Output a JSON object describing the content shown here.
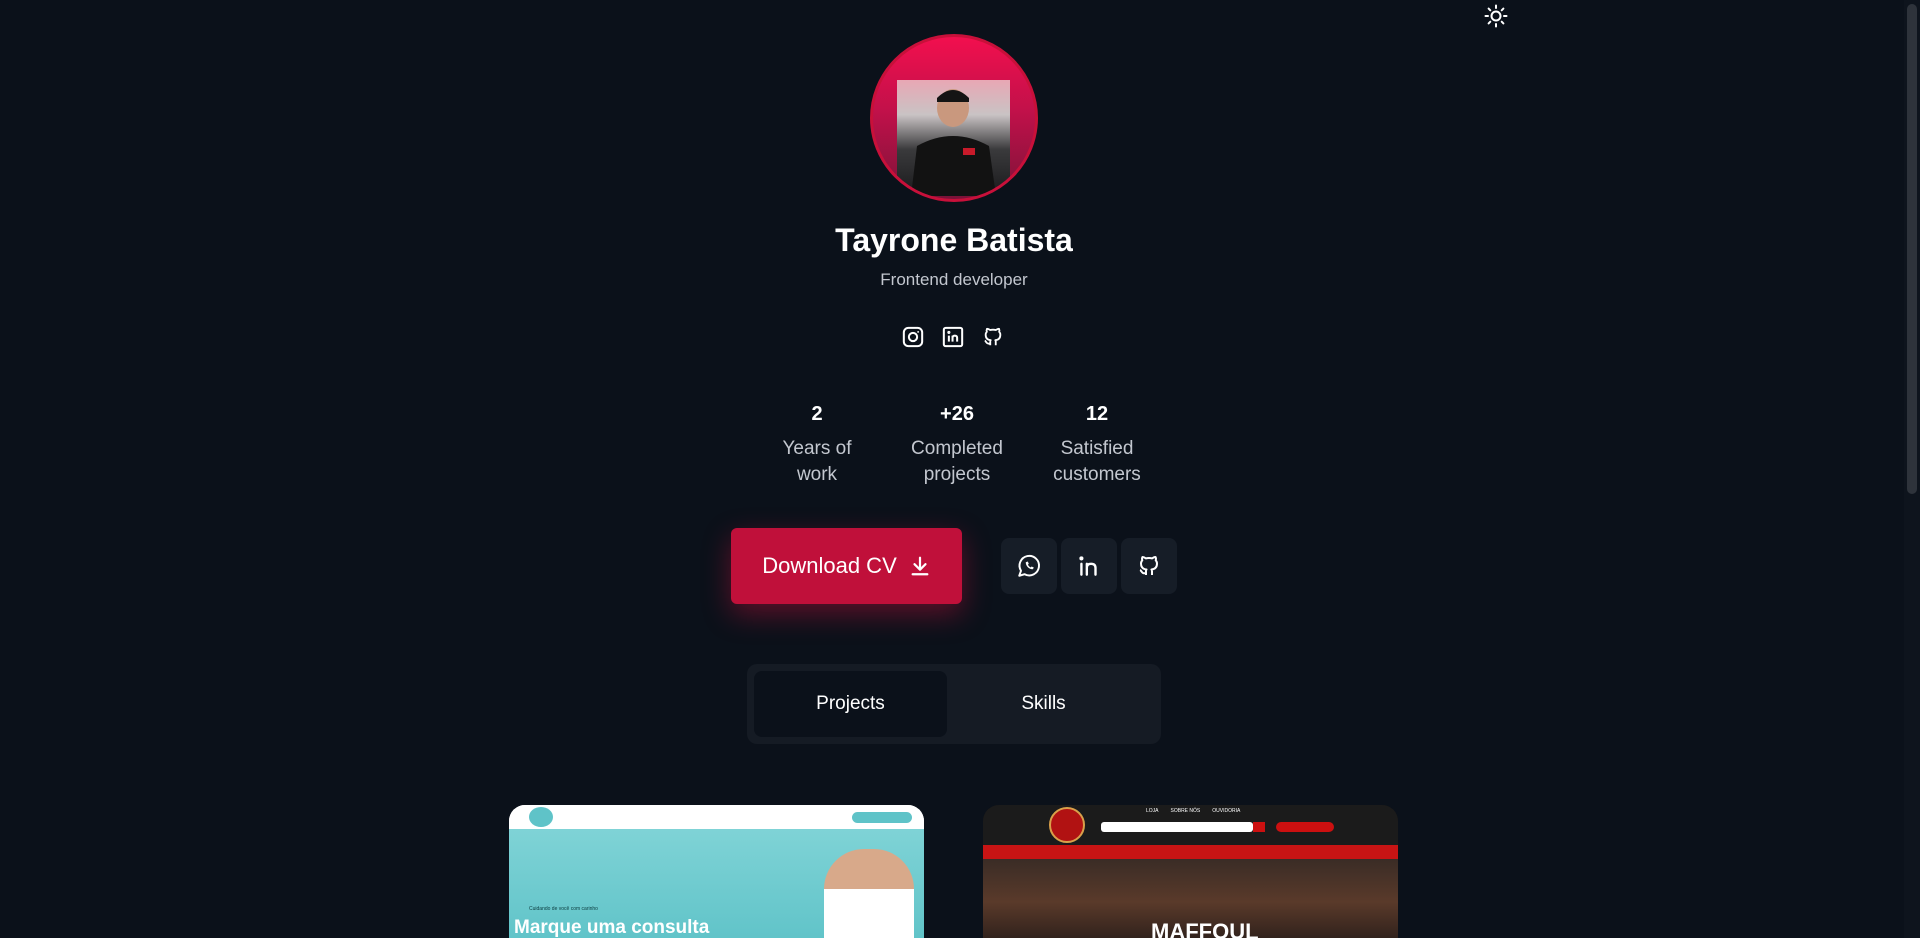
{
  "profile": {
    "name": "Tayrone Batista",
    "role": "Frontend developer"
  },
  "social_small": [
    {
      "icon": "instagram-icon"
    },
    {
      "icon": "linkedin-icon"
    },
    {
      "icon": "github-icon"
    }
  ],
  "stats": [
    {
      "value": "2",
      "label": "Years of work"
    },
    {
      "value": "+26",
      "label": "Completed projects"
    },
    {
      "value": "12",
      "label": "Satisfied customers"
    }
  ],
  "actions": {
    "download_label": "Download CV",
    "contact_icons": [
      "whatsapp-icon",
      "linkedin-icon",
      "github-icon"
    ]
  },
  "tabs": [
    {
      "label": "Projects",
      "active": true
    },
    {
      "label": "Skills",
      "active": false
    }
  ],
  "projects": [
    {
      "headline": "Marque uma consulta",
      "caption": "Cuidando de você com carinho"
    },
    {
      "headline": "MAFFOUL",
      "menu": [
        "LOJA",
        "SOBRE NÓS",
        "OUVIDORIA"
      ]
    }
  ],
  "colors": {
    "background": "#0b111a",
    "accent": "#c0103a",
    "muted_text": "#c3c7cf",
    "surface": "#151b24"
  }
}
